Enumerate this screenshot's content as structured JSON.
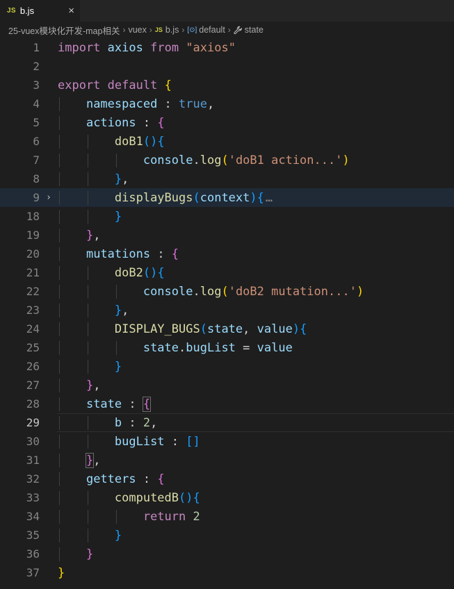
{
  "tab": {
    "badge": "JS",
    "title": "b.js",
    "close": "×"
  },
  "breadcrumbs": {
    "folder": "25-vuex模块化开发-map相关",
    "subfolder": "vuex",
    "file_badge": "JS",
    "file": "b.js",
    "sym_icon": "[⊙]",
    "symbol1": "default",
    "symbol2": "state",
    "sep": "›"
  },
  "lines": [
    {
      "n": "1",
      "indent": 0,
      "t": [
        [
          "kw",
          "import"
        ],
        [
          "pl",
          " "
        ],
        [
          "var",
          "axios"
        ],
        [
          "pl",
          " "
        ],
        [
          "kw",
          "from"
        ],
        [
          "pl",
          " "
        ],
        [
          "str",
          "\"axios\""
        ]
      ]
    },
    {
      "n": "2",
      "indent": 0,
      "t": []
    },
    {
      "n": "3",
      "indent": 0,
      "t": [
        [
          "kw",
          "export"
        ],
        [
          "pl",
          " "
        ],
        [
          "kw",
          "default"
        ],
        [
          "pl",
          " "
        ],
        [
          "b1",
          "{"
        ]
      ]
    },
    {
      "n": "4",
      "indent": 1,
      "t": [
        [
          "var",
          "namespaced"
        ],
        [
          "pl",
          " : "
        ],
        [
          "st",
          "true"
        ],
        [
          "pl",
          ","
        ]
      ]
    },
    {
      "n": "5",
      "indent": 1,
      "t": [
        [
          "var",
          "actions"
        ],
        [
          "pl",
          " : "
        ],
        [
          "b2",
          "{"
        ]
      ]
    },
    {
      "n": "6",
      "indent": 2,
      "t": [
        [
          "fn",
          "doB1"
        ],
        [
          "b3",
          "(){"
        ]
      ]
    },
    {
      "n": "7",
      "indent": 3,
      "t": [
        [
          "var",
          "console"
        ],
        [
          "pl",
          "."
        ],
        [
          "fn",
          "log"
        ],
        [
          "b1",
          "("
        ],
        [
          "str",
          "'doB1 action...'"
        ],
        [
          "b1",
          ")"
        ]
      ]
    },
    {
      "n": "8",
      "indent": 2,
      "t": [
        [
          "b3",
          "}"
        ],
        [
          "pl",
          ","
        ]
      ]
    },
    {
      "n": "9",
      "indent": 2,
      "fold": "›",
      "hl": true,
      "t": [
        [
          "fn",
          "displayBugs"
        ],
        [
          "b3",
          "("
        ],
        [
          "var",
          "context"
        ],
        [
          "b3",
          "){"
        ],
        [
          "ellip",
          "…"
        ]
      ]
    },
    {
      "n": "18",
      "indent": 2,
      "t": [
        [
          "b3",
          "}"
        ]
      ]
    },
    {
      "n": "19",
      "indent": 1,
      "t": [
        [
          "b2",
          "}"
        ],
        [
          "pl",
          ","
        ]
      ]
    },
    {
      "n": "20",
      "indent": 1,
      "t": [
        [
          "var",
          "mutations"
        ],
        [
          "pl",
          " : "
        ],
        [
          "b2",
          "{"
        ]
      ]
    },
    {
      "n": "21",
      "indent": 2,
      "t": [
        [
          "fn",
          "doB2"
        ],
        [
          "b3",
          "(){"
        ]
      ]
    },
    {
      "n": "22",
      "indent": 3,
      "t": [
        [
          "var",
          "console"
        ],
        [
          "pl",
          "."
        ],
        [
          "fn",
          "log"
        ],
        [
          "b1",
          "("
        ],
        [
          "str",
          "'doB2 mutation...'"
        ],
        [
          "b1",
          ")"
        ]
      ]
    },
    {
      "n": "23",
      "indent": 2,
      "t": [
        [
          "b3",
          "}"
        ],
        [
          "pl",
          ","
        ]
      ]
    },
    {
      "n": "24",
      "indent": 2,
      "t": [
        [
          "fn",
          "DISPLAY_BUGS"
        ],
        [
          "b3",
          "("
        ],
        [
          "var",
          "state"
        ],
        [
          "pl",
          ", "
        ],
        [
          "var",
          "value"
        ],
        [
          "b3",
          "){"
        ]
      ]
    },
    {
      "n": "25",
      "indent": 3,
      "t": [
        [
          "var",
          "state"
        ],
        [
          "pl",
          "."
        ],
        [
          "var",
          "bugList"
        ],
        [
          "pl",
          " = "
        ],
        [
          "var",
          "value"
        ]
      ]
    },
    {
      "n": "26",
      "indent": 2,
      "t": [
        [
          "b3",
          "}"
        ]
      ]
    },
    {
      "n": "27",
      "indent": 1,
      "t": [
        [
          "b2",
          "}"
        ],
        [
          "pl",
          ","
        ]
      ]
    },
    {
      "n": "28",
      "indent": 1,
      "t": [
        [
          "var",
          "state"
        ],
        [
          "pl",
          " : "
        ],
        [
          "b2box",
          "{"
        ]
      ]
    },
    {
      "n": "29",
      "indent": 2,
      "cur": true,
      "t": [
        [
          "var",
          "b"
        ],
        [
          "pl",
          " : "
        ],
        [
          "num",
          "2"
        ],
        [
          "pl",
          ","
        ]
      ]
    },
    {
      "n": "30",
      "indent": 2,
      "t": [
        [
          "var",
          "bugList"
        ],
        [
          "pl",
          " : "
        ],
        [
          "b3",
          "[]"
        ]
      ]
    },
    {
      "n": "31",
      "indent": 1,
      "t": [
        [
          "b2box",
          "}"
        ],
        [
          "pl",
          ","
        ]
      ]
    },
    {
      "n": "32",
      "indent": 1,
      "t": [
        [
          "var",
          "getters"
        ],
        [
          "pl",
          " : "
        ],
        [
          "b2",
          "{"
        ]
      ]
    },
    {
      "n": "33",
      "indent": 2,
      "t": [
        [
          "fn",
          "computedB"
        ],
        [
          "b3",
          "(){"
        ]
      ]
    },
    {
      "n": "34",
      "indent": 3,
      "t": [
        [
          "kw",
          "return"
        ],
        [
          "pl",
          " "
        ],
        [
          "num",
          "2"
        ]
      ]
    },
    {
      "n": "35",
      "indent": 2,
      "t": [
        [
          "b3",
          "}"
        ]
      ]
    },
    {
      "n": "36",
      "indent": 1,
      "t": [
        [
          "b2",
          "}"
        ]
      ]
    },
    {
      "n": "37",
      "indent": 0,
      "t": [
        [
          "b1",
          "}"
        ]
      ]
    }
  ]
}
